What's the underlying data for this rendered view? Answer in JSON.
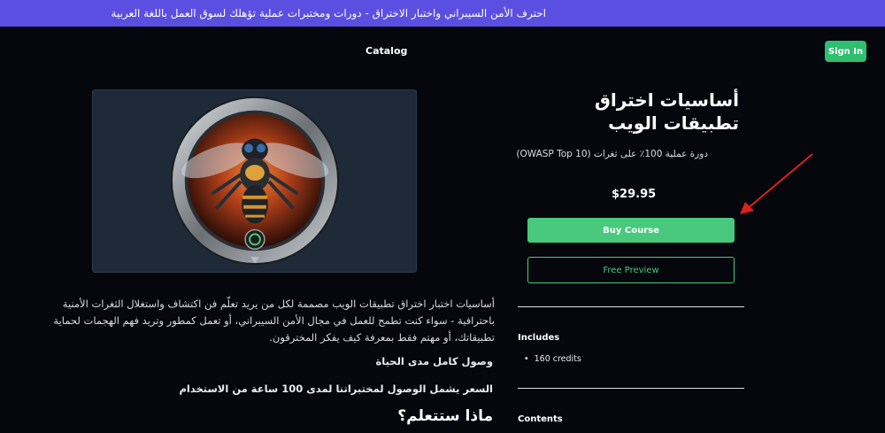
{
  "banner": {
    "text": "احترف الأمن السيبراني واختبار الاختراق - دورات ومختبرات عملية تؤهلك لسوق العمل باللغة العربية"
  },
  "nav": {
    "catalog": "Catalog",
    "sign_in": "Sign In"
  },
  "course": {
    "title": "أساسيات اختراق تطبيقات الويب",
    "subtitle": "دورة عملية 100٪ على ثغرات (OWASP Top 10)",
    "price": "$29.95",
    "buy_label": "Buy Course",
    "preview_label": "Free Preview"
  },
  "sidebar": {
    "includes_heading": "Includes",
    "includes_items": [
      "160 credits"
    ],
    "contents_heading": "Contents"
  },
  "description": {
    "body": "أساسيات اختبار اختراق تطبيقات الويب مصممة لكل من يريد تعلّم فن اكتشاف واستغلال الثغرات الأمنية باحترافية - سواء كنت تطمح للعمل في مجال الأمن السيبراني، أو تعمل كمطور وتريد فهم الهجمات لحماية تطبيقاتك، أو مهتم فقط بمعرفة كيف يفكر المخترقون.",
    "feature_1": "وصول كامل مدى الحياة",
    "feature_2": "السعر يشمل الوصول لمختبراتنا لمدى 100 ساعة من الاستخدام",
    "learn_heading": "ماذا ستتعلم؟"
  },
  "colors": {
    "banner": "#5a4fe0",
    "accent": "#48c97d",
    "background": "#05070d",
    "annotation_arrow": "#e01e1e"
  }
}
